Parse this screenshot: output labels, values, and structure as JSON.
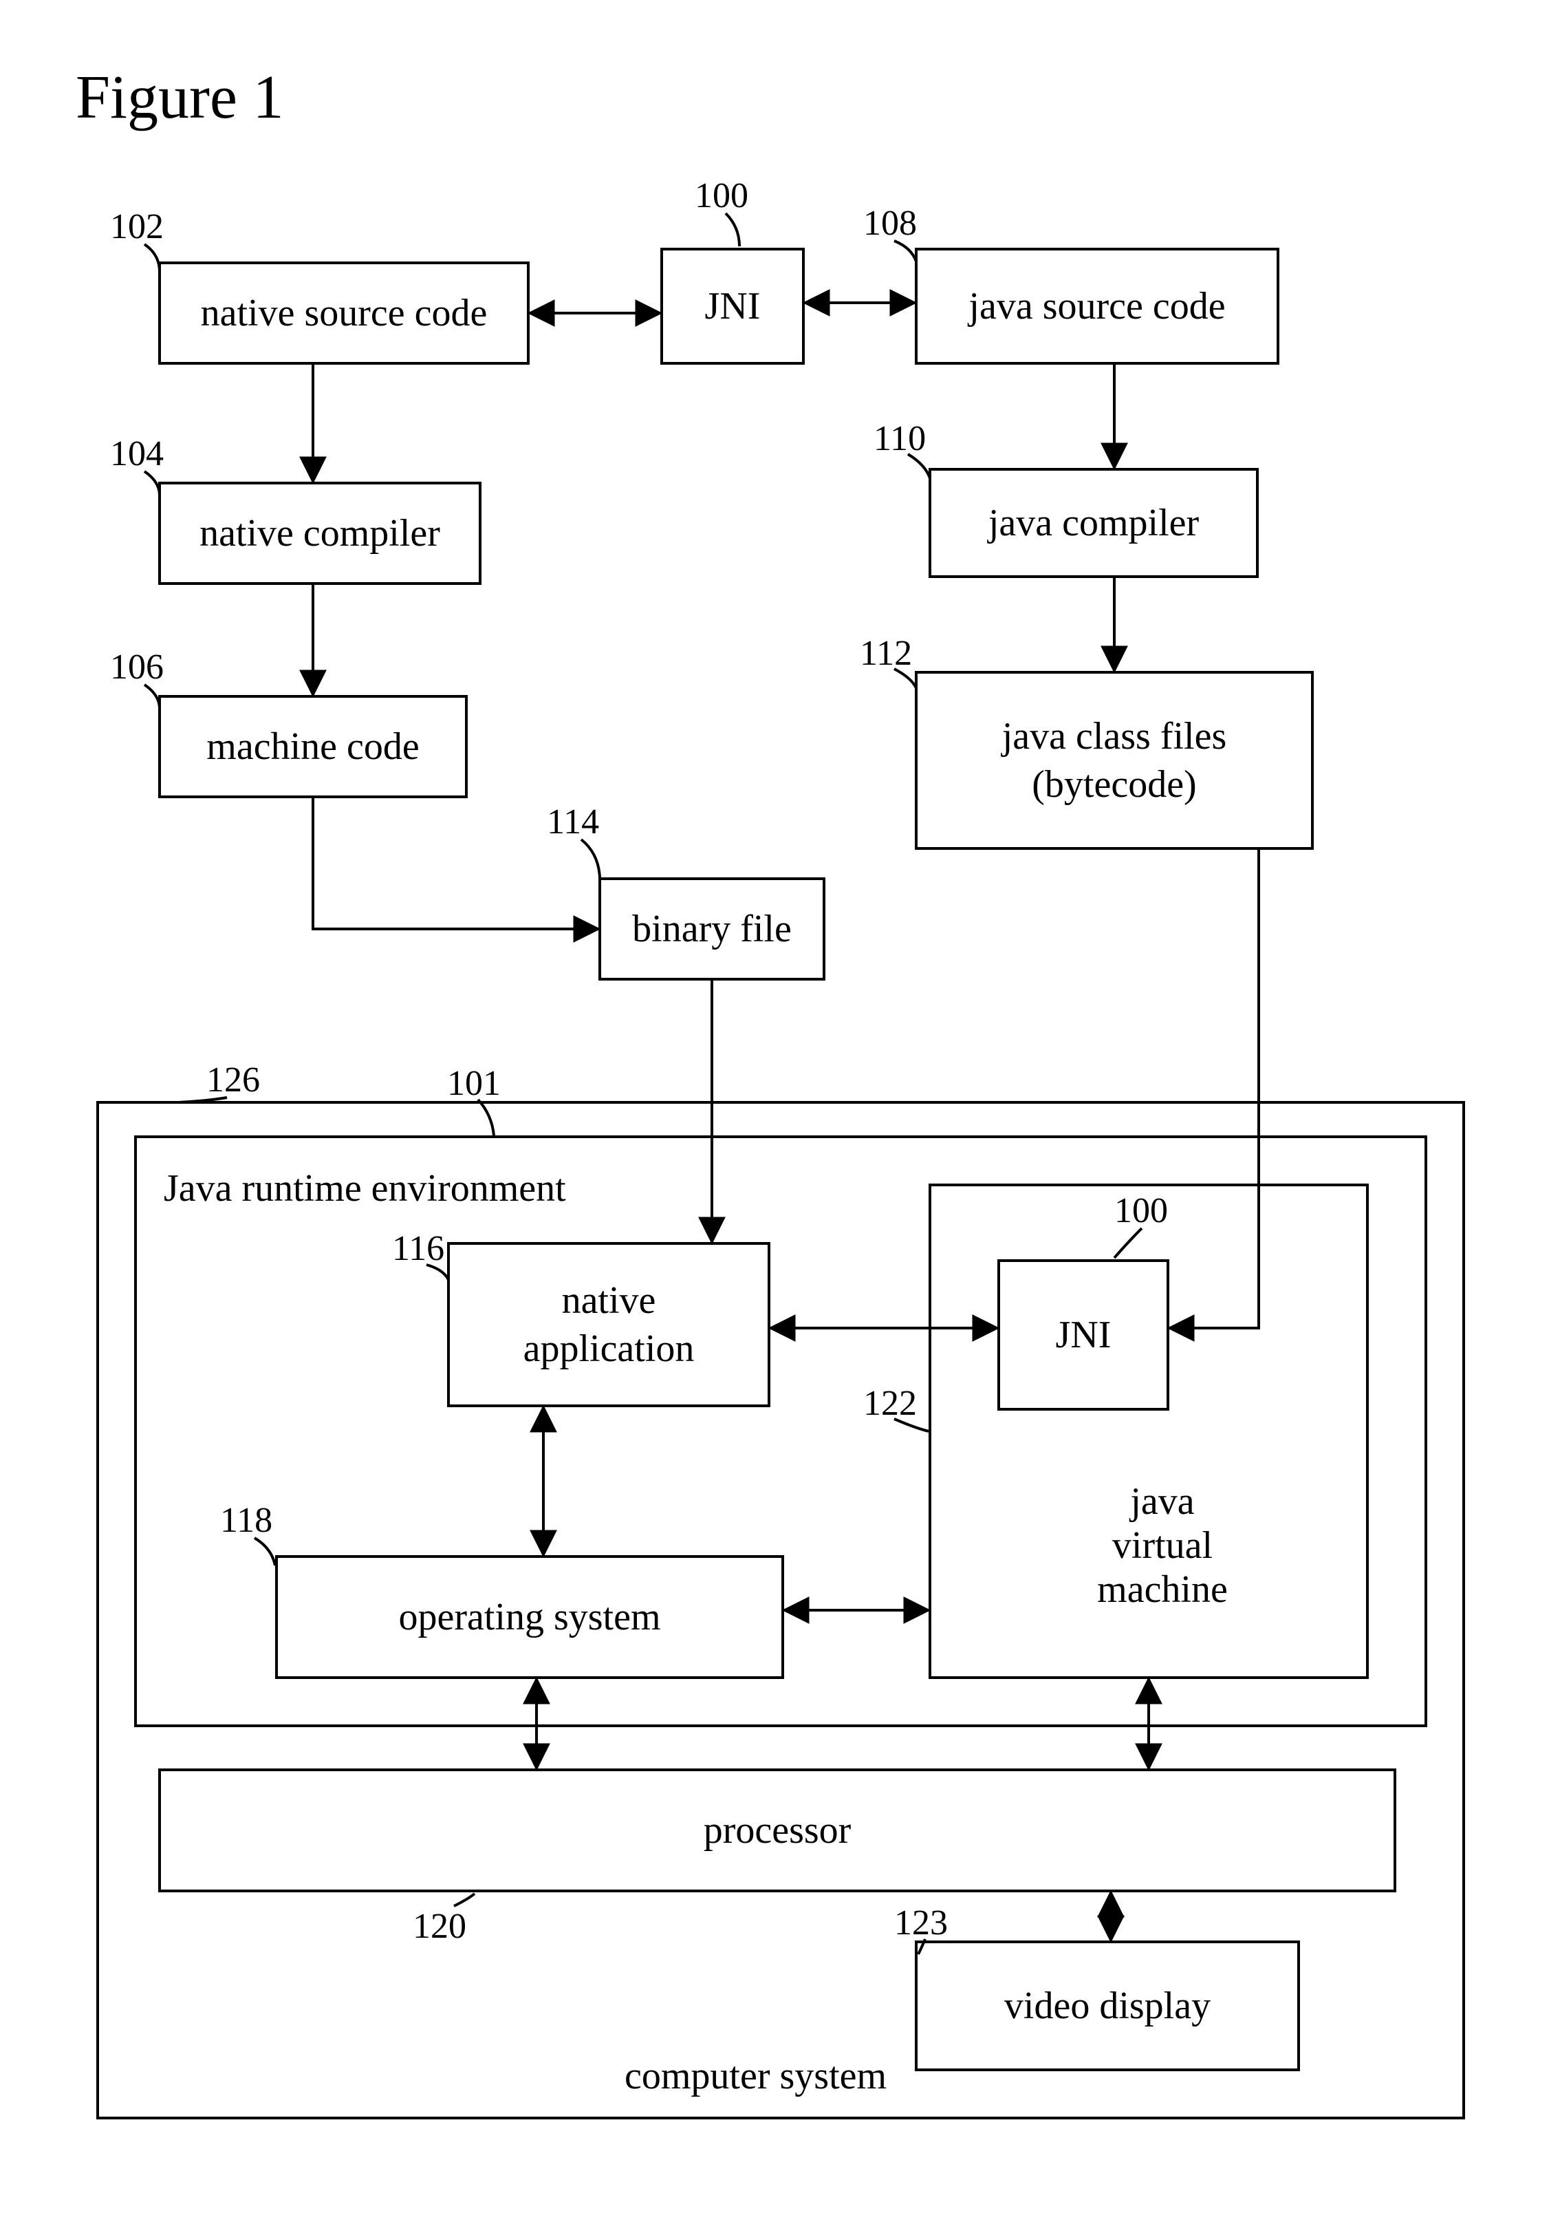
{
  "figure_title": "Figure 1",
  "boxes": {
    "jni_top": "JNI",
    "native_source": "native source code",
    "java_source": "java source code",
    "native_compiler": "native compiler",
    "java_compiler": "java compiler",
    "machine_code": "machine code",
    "java_class_files_l1": "java class files",
    "java_class_files_l2": "(bytecode)",
    "binary_file": "binary file",
    "native_app_l1": "native",
    "native_app_l2": "application",
    "jni_inner": "JNI",
    "jvm_l1": "java",
    "jvm_l2": "virtual",
    "jvm_l3": "machine",
    "operating_system": "operating system",
    "processor": "processor",
    "video_display": "video display"
  },
  "labels": {
    "jre": "Java runtime environment",
    "computer_system": "computer system"
  },
  "refs": {
    "r100a": "100",
    "r102": "102",
    "r108": "108",
    "r104": "104",
    "r110": "110",
    "r106": "106",
    "r112": "112",
    "r114": "114",
    "r126": "126",
    "r101": "101",
    "r116": "116",
    "r100b": "100",
    "r118": "118",
    "r122": "122",
    "r120": "120",
    "r123": "123"
  }
}
